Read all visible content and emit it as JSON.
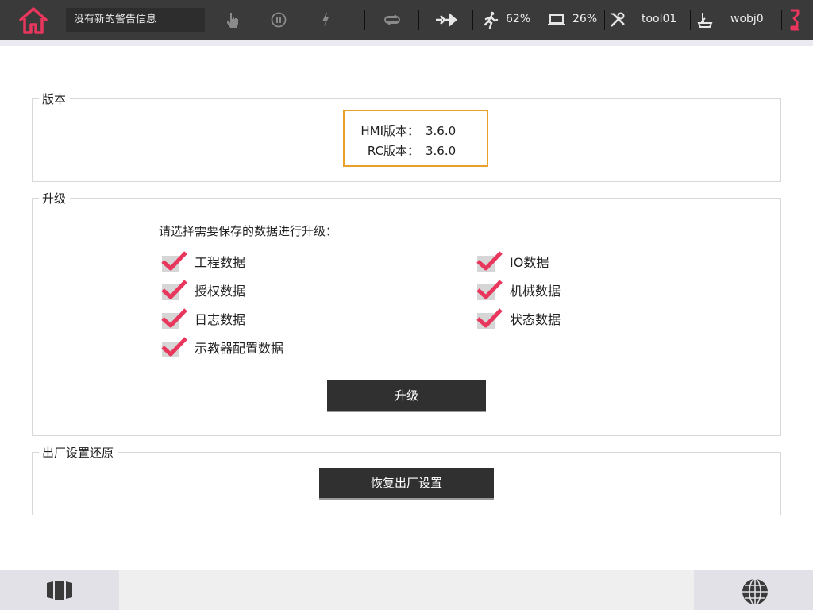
{
  "topbar": {
    "alert_text": "没有新的警告信息",
    "speed": "62%",
    "load": "26%",
    "tool": "tool01",
    "wobj": "wobj0",
    "accent": "#e8365d"
  },
  "version": {
    "legend": "版本",
    "hmi_label": "HMI版本：",
    "hmi_value": "3.6.0",
    "rc_label": "RC版本：",
    "rc_value": "3.6.0",
    "border_color": "#e8a028"
  },
  "upgrade": {
    "legend": "升级",
    "prompt": "请选择需要保存的数据进行升级：",
    "options": [
      {
        "label": "工程数据",
        "checked": true
      },
      {
        "label": "IO数据",
        "checked": true
      },
      {
        "label": "授权数据",
        "checked": true
      },
      {
        "label": "机械数据",
        "checked": true
      },
      {
        "label": "日志数据",
        "checked": true
      },
      {
        "label": "状态数据",
        "checked": true
      },
      {
        "label": "示教器配置数据",
        "checked": true
      }
    ],
    "button": "升级"
  },
  "factory": {
    "legend": "出厂设置还原",
    "button": "恢复出厂设置"
  },
  "bottombar": {
    "left_icon": "panels-icon",
    "right_icon": "globe-icon"
  }
}
